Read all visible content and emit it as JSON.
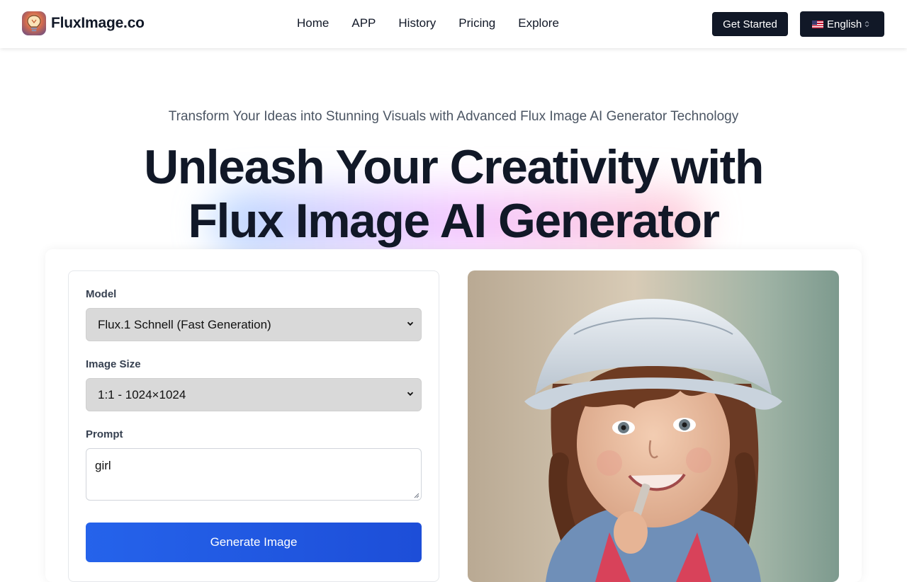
{
  "header": {
    "brand": "FluxImage.co",
    "nav": [
      "Home",
      "APP",
      "History",
      "Pricing",
      "Explore"
    ],
    "get_started": "Get Started",
    "language": "English"
  },
  "hero": {
    "subtitle": "Transform Your Ideas into Stunning Visuals with Advanced Flux Image AI Generator Technology",
    "title_line1": "Unleash Your Creativity with",
    "title_line2": "Flux Image AI Generator"
  },
  "form": {
    "model_label": "Model",
    "model_value": "Flux.1 Schnell (Fast Generation)",
    "size_label": "Image Size",
    "size_value": "1:1 - 1024×1024",
    "prompt_label": "Prompt",
    "prompt_value": "girl",
    "generate_label": "Generate Image"
  },
  "preview": {
    "subject": "smiling girl in white bucket hat"
  },
  "colors": {
    "dark": "#111827",
    "primary": "#2563eb",
    "select_bg": "#d9d9d9"
  }
}
